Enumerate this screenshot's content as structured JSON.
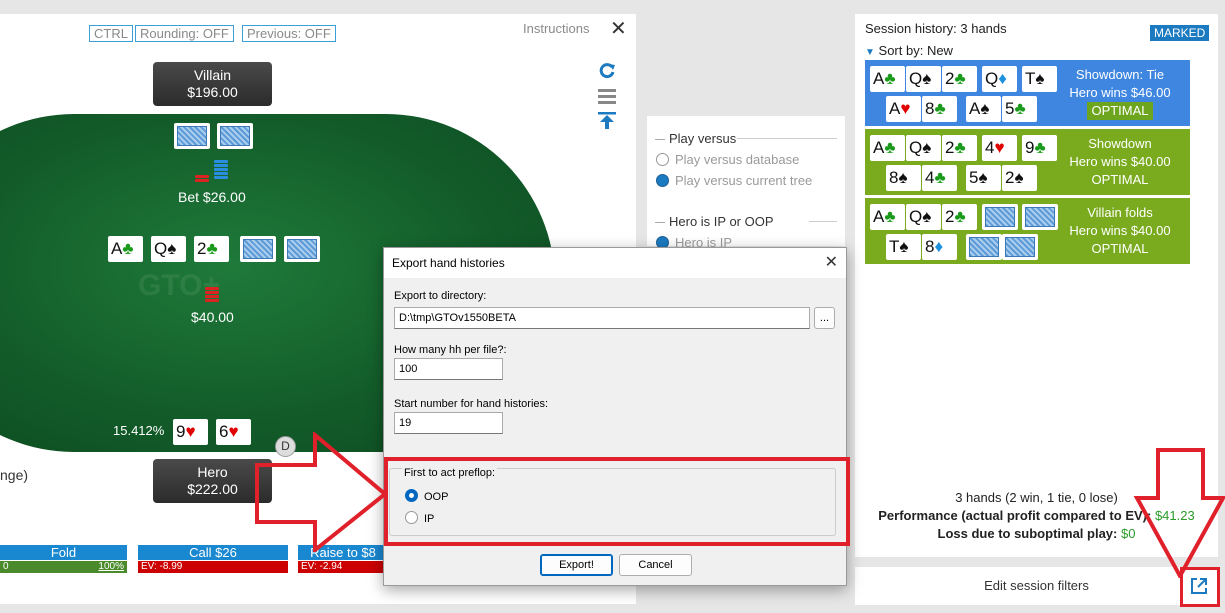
{
  "colors": {
    "accent": "#1c7ac0",
    "felt": "#135d2a",
    "hand_green": "#79aa1f",
    "hand_blue": "#3f86e0",
    "annotation_red": "#e0202a",
    "ev_red": "#cc0000"
  },
  "toolbar": {
    "ctrl": "CTRL",
    "rounding": "Rounding: OFF",
    "previous": "Previous: OFF",
    "instructions": "Instructions",
    "close": "✕"
  },
  "table": {
    "watermark": "GTO+",
    "villain": {
      "name": "Villain",
      "stack": "$196.00",
      "bet": "Bet $26.00"
    },
    "board": [
      {
        "rank": "A",
        "suit": "♣",
        "suit_color": "green"
      },
      {
        "rank": "Q",
        "suit": "♠",
        "suit_color": "black"
      },
      {
        "rank": "2",
        "suit": "♣",
        "suit_color": "green"
      }
    ],
    "pot": "$40.00",
    "hero": {
      "name": "Hero",
      "stack": "$222.00",
      "equity": "15.412%",
      "cards": [
        {
          "rank": "9",
          "suit": "♥",
          "suit_color": "red"
        },
        {
          "rank": "6",
          "suit": "♥",
          "suit_color": "red"
        }
      ]
    },
    "dealer": "D",
    "range_text": "nge)"
  },
  "actions": {
    "fold": {
      "label": "Fold",
      "ev": "0",
      "freq": "100%"
    },
    "call": {
      "label": "Call $26",
      "ev": "EV: -8.99"
    },
    "raise": {
      "label": "Raise to $8",
      "ev": "EV: -2.94"
    }
  },
  "play_mode": {
    "title": "Play versus",
    "options": [
      {
        "label": "Play versus database",
        "selected": false
      },
      {
        "label": "Play versus current tree",
        "selected": true
      }
    ],
    "ip_title": "Hero is IP or OOP",
    "ip_options": [
      {
        "label": "Hero is IP",
        "selected": true
      }
    ]
  },
  "session": {
    "title": "Session history: 3 hands",
    "marked": "MARKED",
    "sort": "Sort by: New",
    "hands": [
      {
        "result": "Showdown: Tie",
        "win": "Hero wins $46.00",
        "tag": "OPTIMAL",
        "board": [
          {
            "rank": "A",
            "suit": "♣",
            "suit_color": "green"
          },
          {
            "rank": "Q",
            "suit": "♠",
            "suit_color": "black"
          },
          {
            "rank": "2",
            "suit": "♣",
            "suit_color": "green"
          },
          {
            "rank": "Q",
            "suit": "♦",
            "suit_color": "blue"
          },
          {
            "rank": "T",
            "suit": "♠",
            "suit_color": "black"
          }
        ],
        "hero": [
          {
            "rank": "A",
            "suit": "♥",
            "suit_color": "red"
          },
          {
            "rank": "8",
            "suit": "♣",
            "suit_color": "green"
          }
        ],
        "villain": [
          {
            "rank": "A",
            "suit": "♠",
            "suit_color": "black"
          },
          {
            "rank": "5",
            "suit": "♣",
            "suit_color": "green"
          }
        ]
      },
      {
        "result": "Showdown",
        "win": "Hero wins $40.00",
        "tag": "OPTIMAL",
        "board": [
          {
            "rank": "A",
            "suit": "♣",
            "suit_color": "green"
          },
          {
            "rank": "Q",
            "suit": "♠",
            "suit_color": "black"
          },
          {
            "rank": "2",
            "suit": "♣",
            "suit_color": "green"
          },
          {
            "rank": "4",
            "suit": "♥",
            "suit_color": "red"
          },
          {
            "rank": "9",
            "suit": "♣",
            "suit_color": "green"
          }
        ],
        "hero": [
          {
            "rank": "8",
            "suit": "♠",
            "suit_color": "black"
          },
          {
            "rank": "4",
            "suit": "♣",
            "suit_color": "green"
          }
        ],
        "villain": [
          {
            "rank": "5",
            "suit": "♠",
            "suit_color": "black"
          },
          {
            "rank": "2",
            "suit": "♠",
            "suit_color": "black"
          }
        ]
      },
      {
        "result": "Villain folds",
        "win": "Hero wins $40.00",
        "tag": "OPTIMAL",
        "board": [
          {
            "rank": "A",
            "suit": "♣",
            "suit_color": "green"
          },
          {
            "rank": "Q",
            "suit": "♠",
            "suit_color": "black"
          },
          {
            "rank": "2",
            "suit": "♣",
            "suit_color": "green"
          }
        ],
        "hero": [
          {
            "rank": "T",
            "suit": "♠",
            "suit_color": "black"
          },
          {
            "rank": "8",
            "suit": "♦",
            "suit_color": "blue"
          }
        ],
        "villain": []
      }
    ],
    "summary": "3 hands (2 win, 1 tie, 0 lose)",
    "performance_label": "Performance (actual profit compared to EV):",
    "performance_value": "$41.23",
    "loss_label": "Loss due to suboptimal play:",
    "loss_value": "$0",
    "edit_filters": "Edit session filters"
  },
  "dialog": {
    "title": "Export hand histories",
    "dir_label": "Export to directory:",
    "dir_value": "D:\\tmp\\GTOv1550BETA",
    "browse": "...",
    "hh_label": "How many hh per file?:",
    "hh_value": "100",
    "start_label": "Start number for hand histories:",
    "start_value": "19",
    "pref_label": "First to act preflop:",
    "pref_options": [
      {
        "label": "OOP",
        "selected": true
      },
      {
        "label": "IP",
        "selected": false
      }
    ],
    "export": "Export!",
    "cancel": "Cancel"
  }
}
